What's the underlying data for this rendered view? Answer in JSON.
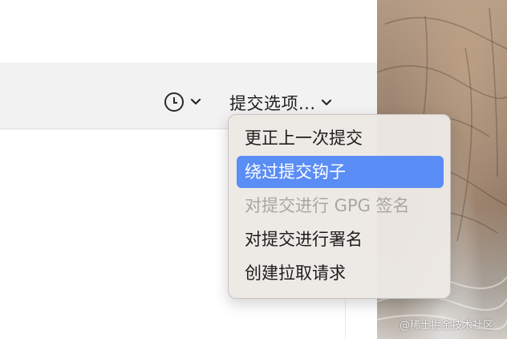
{
  "toolbar": {
    "history_icon": "clock-icon",
    "commit_options_label": "提交选项..."
  },
  "menu": {
    "items": [
      {
        "label": "更正上一次提交",
        "state": "normal"
      },
      {
        "label": "绕过提交钩子",
        "state": "highlighted"
      },
      {
        "label": "对提交进行 GPG 签名",
        "state": "disabled"
      },
      {
        "label": "对提交进行署名",
        "state": "normal"
      },
      {
        "label": "创建拉取请求",
        "state": "normal"
      }
    ]
  },
  "watermark": "@稀土掘金技术社区",
  "colors": {
    "highlight": "#5a8df5",
    "toolbar_bg": "#f2f2f3",
    "menu_bg": "#ece8e4",
    "disabled_text": "#a9a6a3"
  }
}
